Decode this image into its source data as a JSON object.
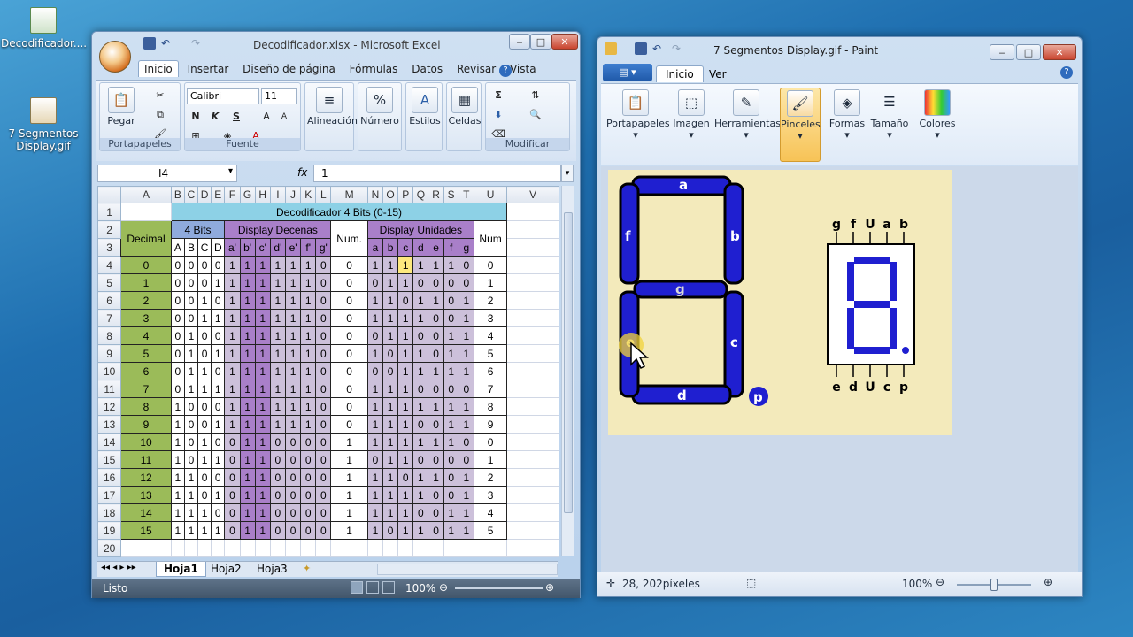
{
  "desktop": {
    "icons": [
      {
        "label": "Decodificador...."
      },
      {
        "label": "7 Segmentos Display.gif"
      }
    ]
  },
  "excel": {
    "title": "Decodificador.xlsx - Microsoft Excel",
    "tabs": [
      "Inicio",
      "Insertar",
      "Diseño de página",
      "Fórmulas",
      "Datos",
      "Revisar",
      "Vista"
    ],
    "ribbon": {
      "paste": "Pegar",
      "clipboard": "Portapapeles",
      "font_name": "Calibri",
      "font_size": "11",
      "bold": "N",
      "italic": "K",
      "underline": "S",
      "font_group": "Fuente",
      "align": "Alineación",
      "number": "Número",
      "styles": "Estilos",
      "cells": "Celdas",
      "modify": "Modificar"
    },
    "name_box": "I4",
    "fx": "fx",
    "formula": "1",
    "columns": [
      "A",
      "B",
      "C",
      "D",
      "E",
      "F",
      "G",
      "H",
      "I",
      "J",
      "K",
      "L",
      "M",
      "N",
      "O",
      "P",
      "Q",
      "R",
      "S",
      "T",
      "U",
      "V"
    ],
    "sheet": {
      "title": "Decodificador 4 Bits (0-15)",
      "decimal": "Decimal",
      "bits": "4 Bits",
      "dec_disp": "Display Decenas",
      "num1": "Num.",
      "uni_disp": "Display Unidades",
      "num2": "Num",
      "bit_cols": [
        "A",
        "B",
        "C",
        "D"
      ],
      "dec_cols": [
        "a'",
        "b'",
        "c'",
        "d'",
        "e'",
        "f'",
        "g'"
      ],
      "uni_cols": [
        "a",
        "b",
        "c",
        "d",
        "e",
        "f",
        "g"
      ],
      "rows": [
        [
          "0",
          "0",
          "0",
          "0",
          "0",
          "1",
          "1",
          "1",
          "1",
          "1",
          "1",
          "0",
          "0",
          "1",
          "1",
          "1",
          "1",
          "1",
          "1",
          "0",
          "0"
        ],
        [
          "1",
          "0",
          "0",
          "0",
          "1",
          "1",
          "1",
          "1",
          "1",
          "1",
          "1",
          "0",
          "0",
          "0",
          "1",
          "1",
          "0",
          "0",
          "0",
          "0",
          "1"
        ],
        [
          "2",
          "0",
          "0",
          "1",
          "0",
          "1",
          "1",
          "1",
          "1",
          "1",
          "1",
          "0",
          "0",
          "1",
          "1",
          "0",
          "1",
          "1",
          "0",
          "1",
          "2"
        ],
        [
          "3",
          "0",
          "0",
          "1",
          "1",
          "1",
          "1",
          "1",
          "1",
          "1",
          "1",
          "0",
          "0",
          "1",
          "1",
          "1",
          "1",
          "0",
          "0",
          "1",
          "3"
        ],
        [
          "4",
          "0",
          "1",
          "0",
          "0",
          "1",
          "1",
          "1",
          "1",
          "1",
          "1",
          "0",
          "0",
          "0",
          "1",
          "1",
          "0",
          "0",
          "1",
          "1",
          "4"
        ],
        [
          "5",
          "0",
          "1",
          "0",
          "1",
          "1",
          "1",
          "1",
          "1",
          "1",
          "1",
          "0",
          "0",
          "1",
          "0",
          "1",
          "1",
          "0",
          "1",
          "1",
          "5"
        ],
        [
          "6",
          "0",
          "1",
          "1",
          "0",
          "1",
          "1",
          "1",
          "1",
          "1",
          "1",
          "0",
          "0",
          "0",
          "0",
          "1",
          "1",
          "1",
          "1",
          "1",
          "6"
        ],
        [
          "7",
          "0",
          "1",
          "1",
          "1",
          "1",
          "1",
          "1",
          "1",
          "1",
          "1",
          "0",
          "0",
          "1",
          "1",
          "1",
          "0",
          "0",
          "0",
          "0",
          "7"
        ],
        [
          "8",
          "1",
          "0",
          "0",
          "0",
          "1",
          "1",
          "1",
          "1",
          "1",
          "1",
          "0",
          "0",
          "1",
          "1",
          "1",
          "1",
          "1",
          "1",
          "1",
          "8"
        ],
        [
          "9",
          "1",
          "0",
          "0",
          "1",
          "1",
          "1",
          "1",
          "1",
          "1",
          "1",
          "0",
          "0",
          "1",
          "1",
          "1",
          "0",
          "0",
          "1",
          "1",
          "9"
        ],
        [
          "10",
          "1",
          "0",
          "1",
          "0",
          "0",
          "1",
          "1",
          "0",
          "0",
          "0",
          "0",
          "1",
          "1",
          "1",
          "1",
          "1",
          "1",
          "1",
          "0",
          "0"
        ],
        [
          "11",
          "1",
          "0",
          "1",
          "1",
          "0",
          "1",
          "1",
          "0",
          "0",
          "0",
          "0",
          "1",
          "0",
          "1",
          "1",
          "0",
          "0",
          "0",
          "0",
          "1"
        ],
        [
          "12",
          "1",
          "1",
          "0",
          "0",
          "0",
          "1",
          "1",
          "0",
          "0",
          "0",
          "0",
          "1",
          "1",
          "1",
          "0",
          "1",
          "1",
          "0",
          "1",
          "2"
        ],
        [
          "13",
          "1",
          "1",
          "0",
          "1",
          "0",
          "1",
          "1",
          "0",
          "0",
          "0",
          "0",
          "1",
          "1",
          "1",
          "1",
          "1",
          "0",
          "0",
          "1",
          "3"
        ],
        [
          "14",
          "1",
          "1",
          "1",
          "0",
          "0",
          "1",
          "1",
          "0",
          "0",
          "0",
          "0",
          "1",
          "1",
          "1",
          "1",
          "0",
          "0",
          "1",
          "1",
          "4"
        ],
        [
          "15",
          "1",
          "1",
          "1",
          "1",
          "0",
          "1",
          "1",
          "0",
          "0",
          "0",
          "0",
          "1",
          "1",
          "0",
          "1",
          "1",
          "0",
          "1",
          "1",
          "5"
        ]
      ]
    },
    "sheet_tabs": [
      "Hoja1",
      "Hoja2",
      "Hoja3"
    ],
    "status": "Listo",
    "zoom": "100%"
  },
  "paint": {
    "title": "7 Segmentos Display.gif - Paint",
    "tabs": [
      "Inicio",
      "Ver"
    ],
    "tools": [
      "Portapapeles",
      "Imagen",
      "Herramientas",
      "Pinceles",
      "Formas",
      "Tamaño",
      "Colores"
    ],
    "segments": {
      "a": "a",
      "b": "b",
      "c": "c",
      "d": "d",
      "e": "e",
      "f": "f",
      "g": "g",
      "p": "p"
    },
    "pins_top": [
      "g",
      "f",
      "U",
      "a",
      "b"
    ],
    "pins_bottom": [
      "e",
      "d",
      "U",
      "c",
      "p"
    ],
    "coords": "28, 202píxeles",
    "zoom": "100%"
  }
}
